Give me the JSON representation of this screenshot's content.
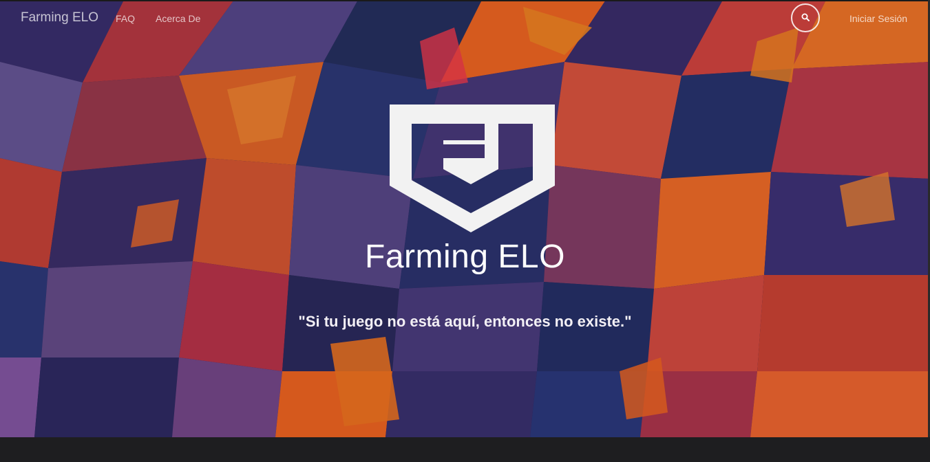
{
  "nav": {
    "brand": "Farming ELO",
    "links": [
      {
        "label": "FAQ"
      },
      {
        "label": "Acerca De"
      }
    ],
    "search_icon": "search-icon",
    "login_label": "Iniciar Sesión"
  },
  "hero": {
    "logo_mark": "FE shield logo",
    "title": "Farming ELO",
    "tagline": "\"Si tu juego no está aquí, entonces no existe.\""
  },
  "colors": {
    "accent_orange": "#ff6a1a",
    "accent_red": "#e8324a",
    "deep_blue": "#1d2a6b",
    "purple": "#5b4a8a",
    "text_white": "#ffffff"
  }
}
